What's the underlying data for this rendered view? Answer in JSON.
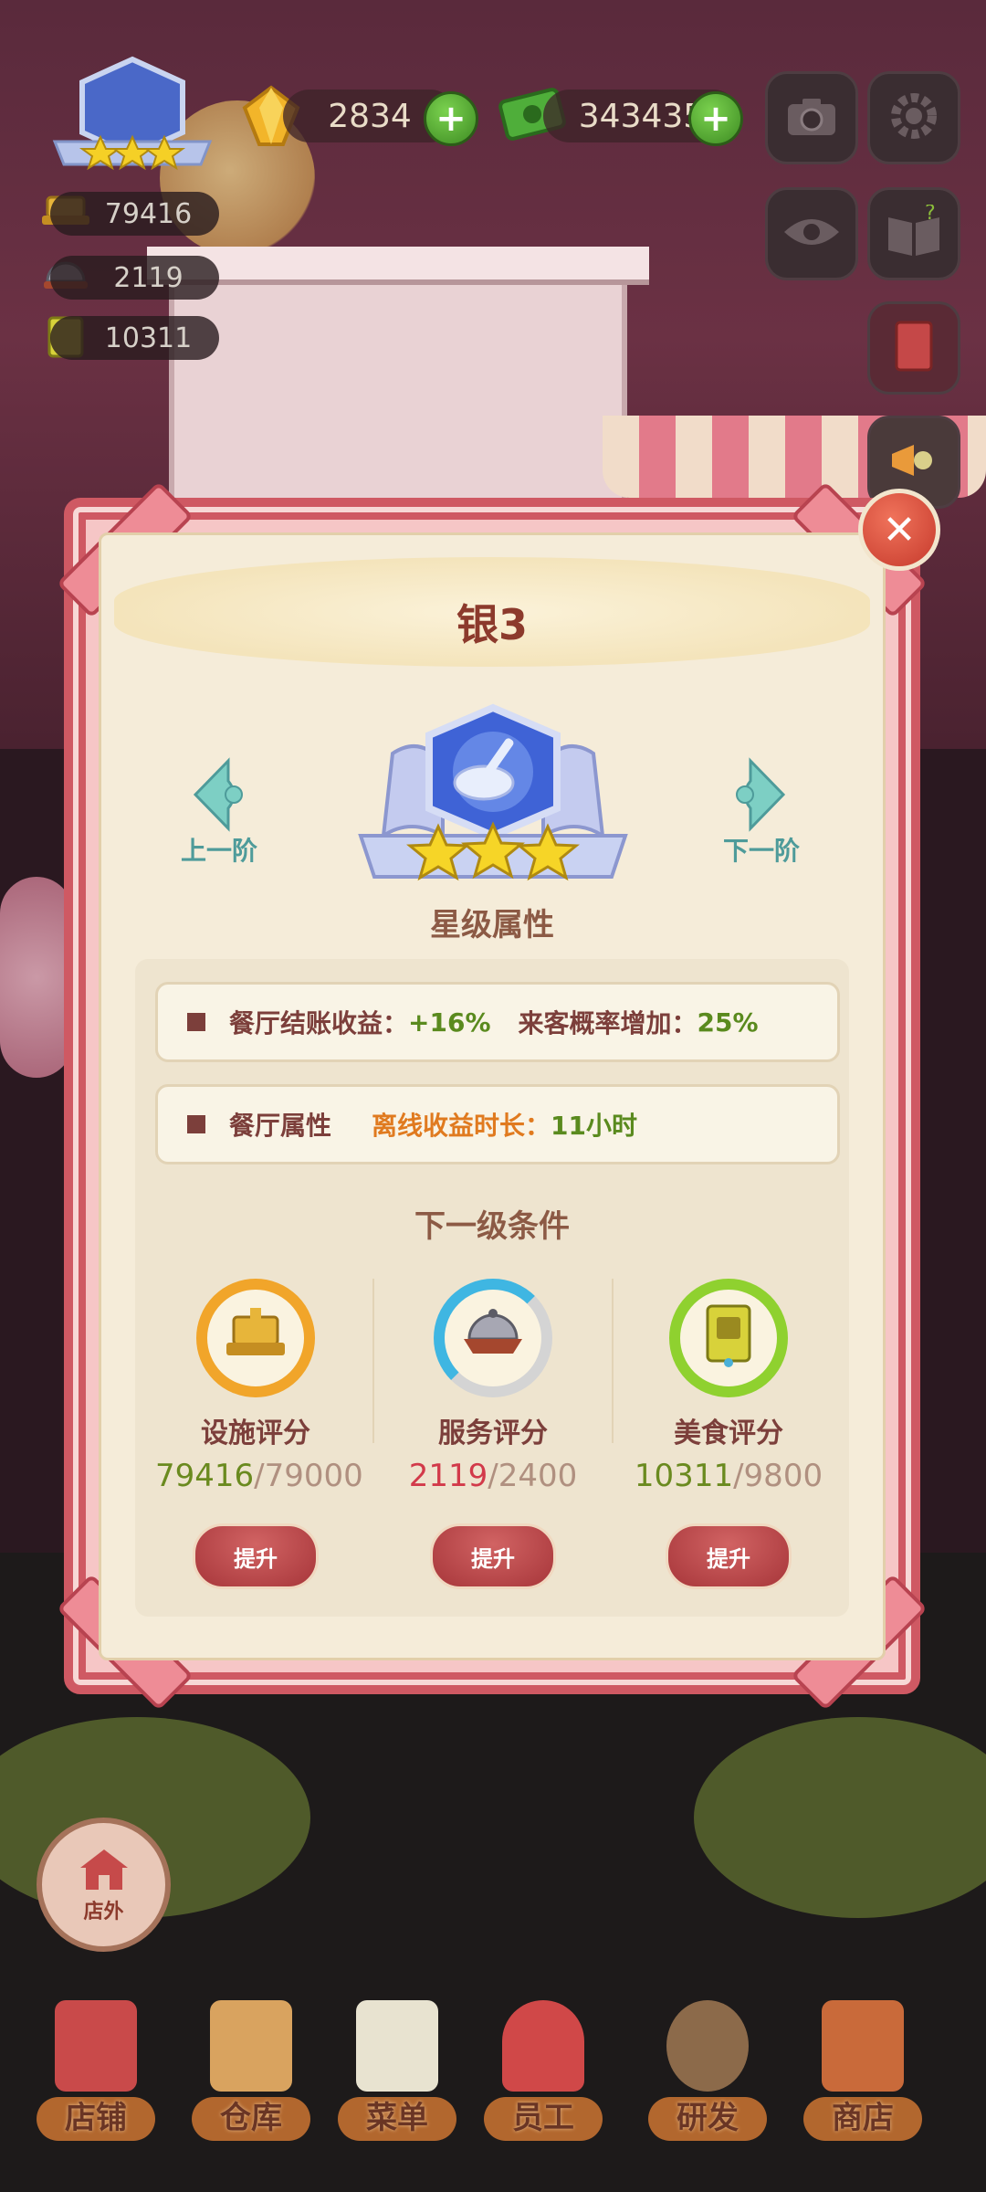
{
  "hud": {
    "gems": "2834",
    "cash": "343435",
    "plus_symbol": "+",
    "stats": [
      {
        "icon": "facility-icon",
        "value": "79416"
      },
      {
        "icon": "service-icon",
        "value": "2119"
      },
      {
        "icon": "food-book-icon",
        "value": "10311"
      }
    ],
    "buttons": [
      "camera-icon",
      "settings-icon",
      "eye-icon",
      "help-book-icon",
      "recipe-book-icon",
      "megaphone-icon"
    ]
  },
  "dialog": {
    "title": "银3",
    "close_symbol": "✕",
    "prev_label": "上一阶",
    "next_label": "下一阶",
    "star_section_title": "星级属性",
    "attr_row1": {
      "label": "餐厅结账收益：",
      "value": "+16%",
      "label2": "来客概率增加：",
      "value2": "25%"
    },
    "attr_row2": {
      "label": "餐厅属性",
      "label2": "离线收益时长：",
      "value2": "11小时"
    },
    "next_level_title": "下一级条件",
    "conditions": [
      {
        "label": "设施评分",
        "current": "79416",
        "target": "/79000",
        "button": "提升",
        "ring_color": "#f1a52a",
        "current_color": "#6a8a1f"
      },
      {
        "label": "服务评分",
        "current": "2119",
        "target": "/2400",
        "button": "提升",
        "ring_color": "#3fb6e2",
        "current_color": "#d23a4a"
      },
      {
        "label": "美食评分",
        "current": "10311",
        "target": "/9800",
        "button": "提升",
        "ring_color": "#8fd12f",
        "current_color": "#6a8a1f"
      }
    ]
  },
  "outside_button": "店外",
  "bottom_nav": [
    "店铺",
    "仓库",
    "菜单",
    "员工",
    "研发",
    "商店"
  ],
  "colors": {
    "frame": "#cf5963",
    "parchment": "#f5ecd9",
    "title": "#8c3a2c",
    "attr_value": "#5a8a1e",
    "offline": "#e07a1f"
  }
}
